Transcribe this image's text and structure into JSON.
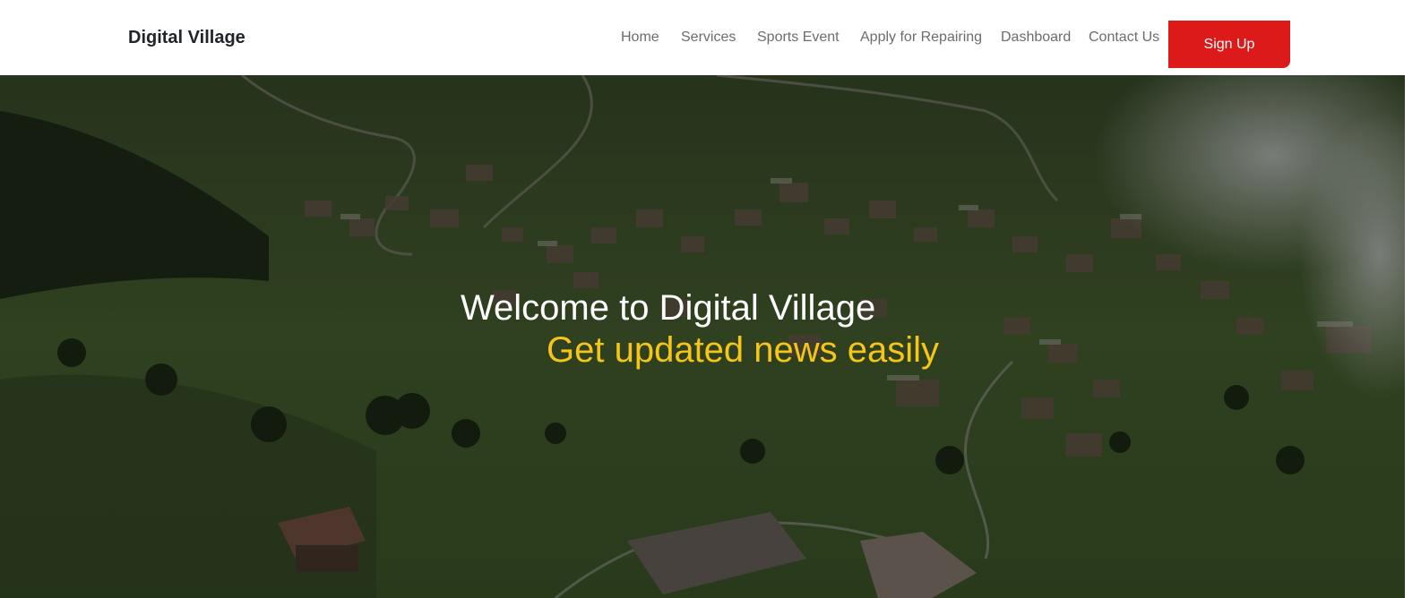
{
  "navbar": {
    "brand": "Digital Village",
    "links": [
      {
        "label": "Home"
      },
      {
        "label": "Services"
      },
      {
        "label": "Sports Event"
      },
      {
        "label": "Apply for Repairing"
      },
      {
        "label": "Dashboard"
      },
      {
        "label": "Contact Us"
      }
    ],
    "signup_label": "Sign Up"
  },
  "hero": {
    "title": "Welcome to Digital Village",
    "subtitle": "Get updated news easily",
    "background_image": "aerial-village-landscape"
  },
  "colors": {
    "signup_bg": "#dc1a1a",
    "subtitle": "#f5c518",
    "nav_link": "#6c6c6c",
    "brand": "#212529"
  }
}
